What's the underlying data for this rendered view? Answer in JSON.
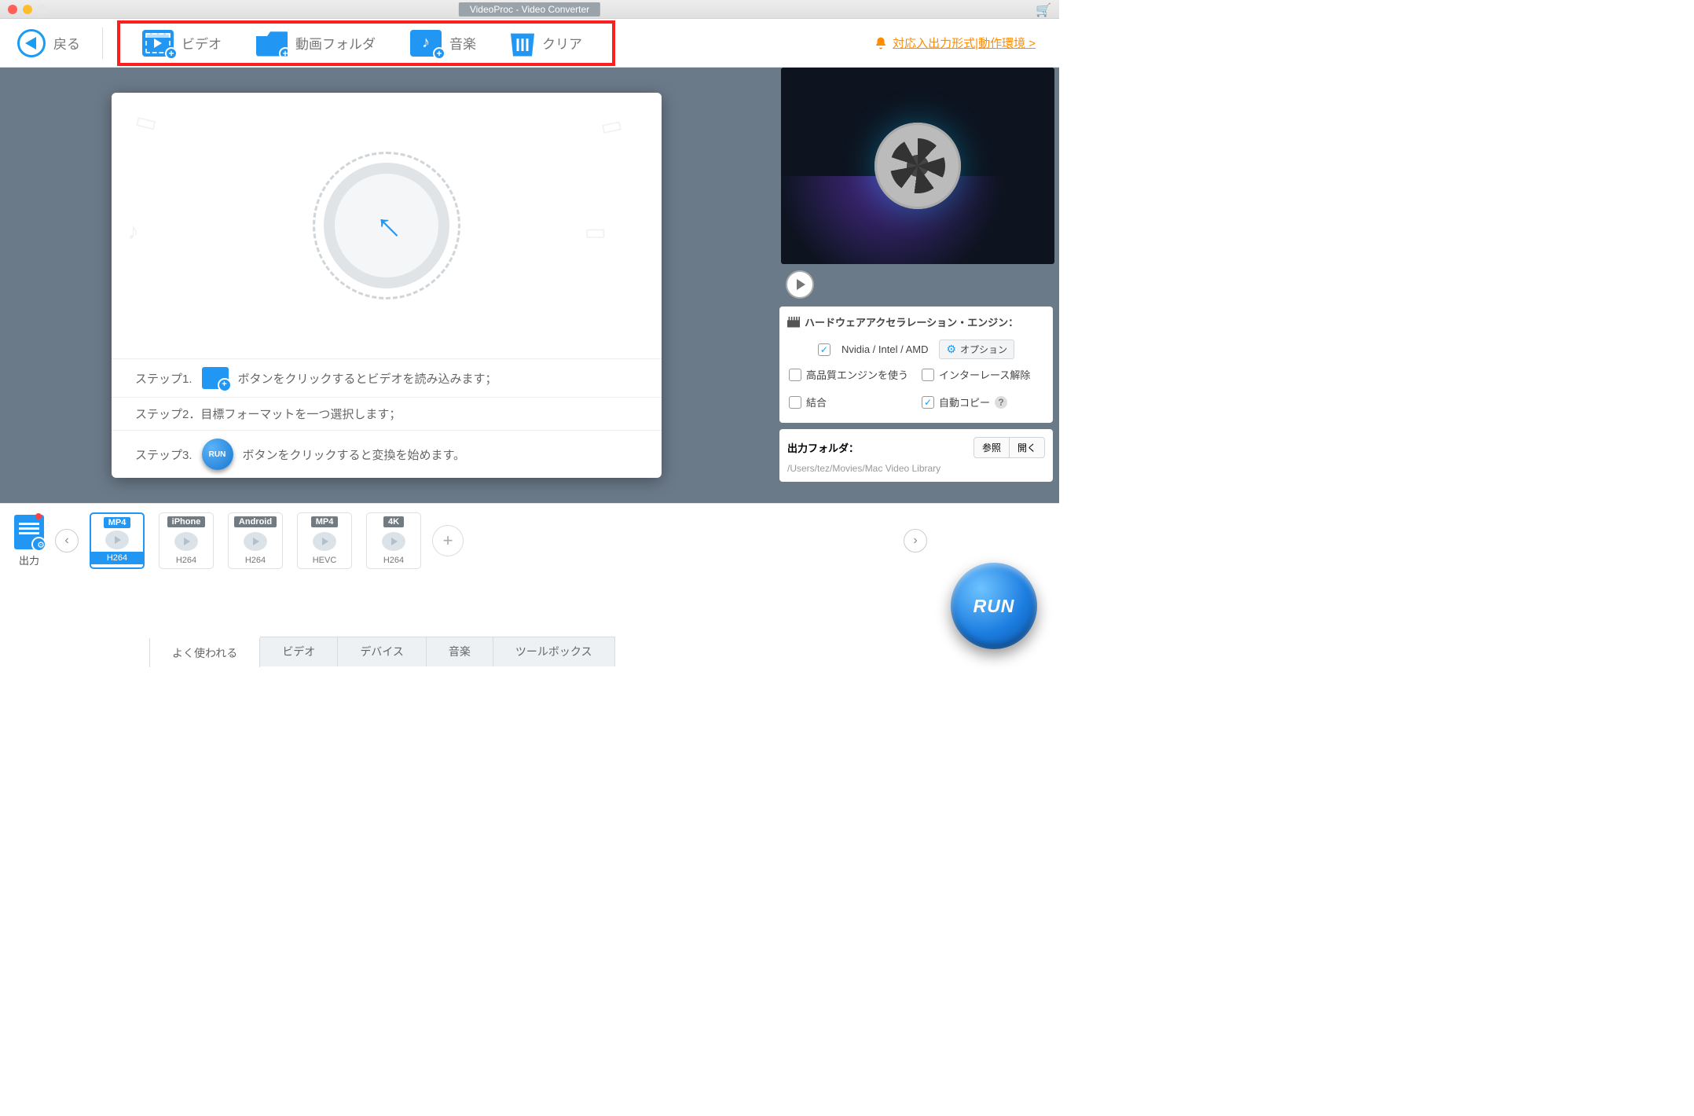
{
  "window": {
    "title": "VideoProc - Video Converter"
  },
  "toolbar": {
    "back": "戻る",
    "video": "ビデオ",
    "folder": "動画フォルダ",
    "music": "音楽",
    "clear": "クリア",
    "notify": "対応入出力形式|動作環境 >"
  },
  "drop": {
    "step1_pre": "ステップ1.",
    "step1_post": "ボタンをクリックするとビデオを読み込みます；",
    "step2": "ステップ2．目標フォーマットを一つ選択します；",
    "step3_pre": "ステップ3.",
    "step3_post": "ボタンをクリックすると変換を始めます。",
    "run_mini": "RUN"
  },
  "side": {
    "hw_title": "ハードウェアアクセラレーション・エンジン：",
    "hw_label": "Nvidia /  Intel / AMD",
    "option_btn": "オプション",
    "hq": "高品質エンジンを使う",
    "deint": "インターレース解除",
    "merge": "結合",
    "autocopy": "自動コピー"
  },
  "output": {
    "label": "出力フォルダ：",
    "browse": "参照",
    "open": "開く",
    "path": "/Users/tez/Movies/Mac Video Library"
  },
  "formats": {
    "out_label": "出力",
    "items": [
      {
        "top": "MP4",
        "bot": "H264",
        "sel": true,
        "alt": false
      },
      {
        "top": "iPhone",
        "bot": "H264",
        "sel": false,
        "alt": true
      },
      {
        "top": "Android",
        "bot": "H264",
        "sel": false,
        "alt": true
      },
      {
        "top": "MP4",
        "bot": "HEVC",
        "sel": false,
        "alt": true
      },
      {
        "top": "4K",
        "bot": "H264",
        "sel": false,
        "alt": true
      }
    ]
  },
  "tabs": {
    "items": [
      "よく使われる",
      "ビデオ",
      "デバイス",
      "音楽",
      "ツールボックス"
    ],
    "active": 0
  },
  "run": "RUN"
}
